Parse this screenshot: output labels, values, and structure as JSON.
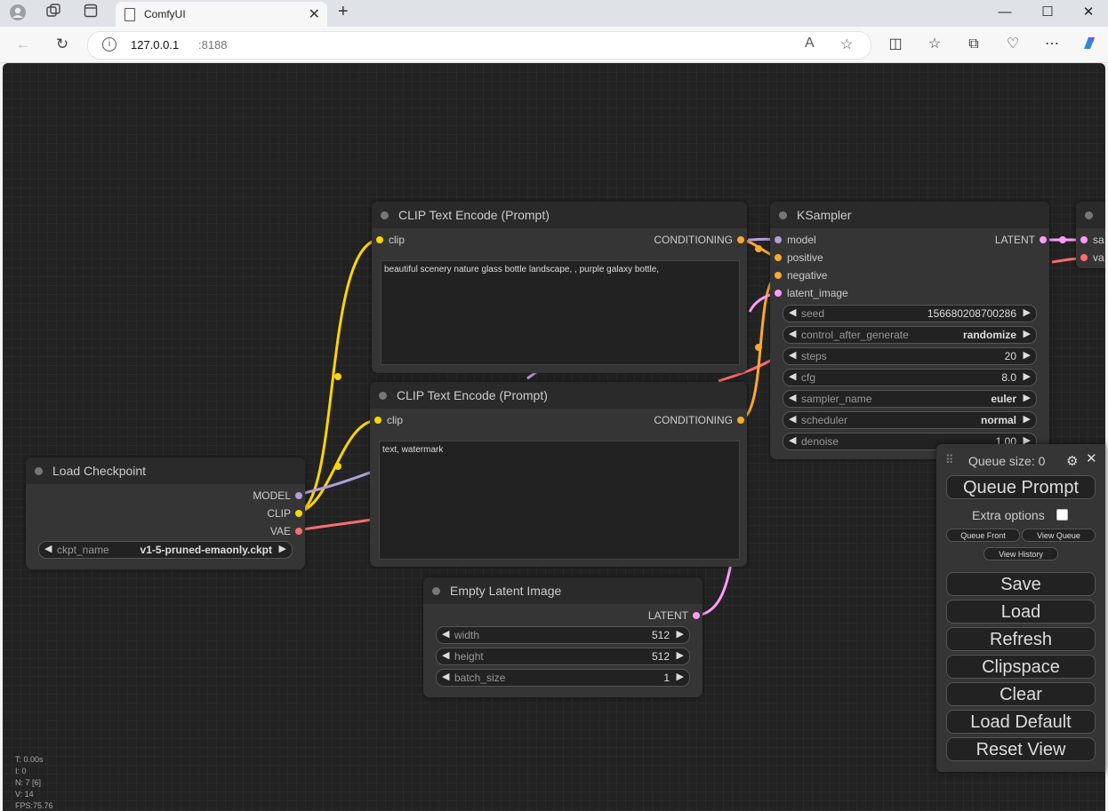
{
  "browser": {
    "tab_title": "ComfyUI",
    "url_host": "127.0.0.1",
    "url_port": ":8188"
  },
  "nodes": {
    "clip_pos": {
      "title": "CLIP Text Encode (Prompt)",
      "input": "clip",
      "output": "CONDITIONING",
      "text": "beautiful scenery nature glass bottle landscape, , purple galaxy bottle,"
    },
    "clip_neg": {
      "title": "CLIP Text Encode (Prompt)",
      "input": "clip",
      "output": "CONDITIONING",
      "text": "text, watermark"
    },
    "checkpoint": {
      "title": "Load Checkpoint",
      "outputs": [
        "MODEL",
        "CLIP",
        "VAE"
      ],
      "widget_label": "ckpt_name",
      "widget_value": "v1-5-pruned-emaonly.ckpt"
    },
    "latent": {
      "title": "Empty Latent Image",
      "output": "LATENT",
      "widgets": [
        {
          "label": "width",
          "value": "512"
        },
        {
          "label": "height",
          "value": "512"
        },
        {
          "label": "batch_size",
          "value": "1"
        }
      ]
    },
    "ksampler": {
      "title": "KSampler",
      "inputs": [
        "model",
        "positive",
        "negative",
        "latent_image"
      ],
      "output": "LATENT",
      "widgets": [
        {
          "label": "seed",
          "value": "156680208700286"
        },
        {
          "label": "control_after_generate",
          "value": "randomize"
        },
        {
          "label": "steps",
          "value": "20"
        },
        {
          "label": "cfg",
          "value": "8.0"
        },
        {
          "label": "sampler_name",
          "value": "euler"
        },
        {
          "label": "scheduler",
          "value": "normal"
        },
        {
          "label": "denoise",
          "value": "1.00"
        }
      ]
    },
    "vae_decode": {
      "inputs": [
        "sa",
        "va"
      ]
    }
  },
  "menu": {
    "queue_size": "Queue size: 0",
    "queue_prompt": "Queue Prompt",
    "extra_options": "Extra options",
    "queue_front": "Queue Front",
    "view_queue": "View Queue",
    "view_history": "View History",
    "buttons": [
      "Save",
      "Load",
      "Refresh",
      "Clipspace",
      "Clear",
      "Load Default",
      "Reset View"
    ]
  },
  "stats": [
    "T: 0.00s",
    "I: 0",
    "N: 7 [6]",
    "V: 14",
    "FPS:75.76"
  ],
  "colors": {
    "clip": "#ffd500",
    "model": "#b39ddb",
    "conditioning": "#ffa931",
    "latent": "#ff9cf9",
    "vae": "#ff6e6e"
  }
}
